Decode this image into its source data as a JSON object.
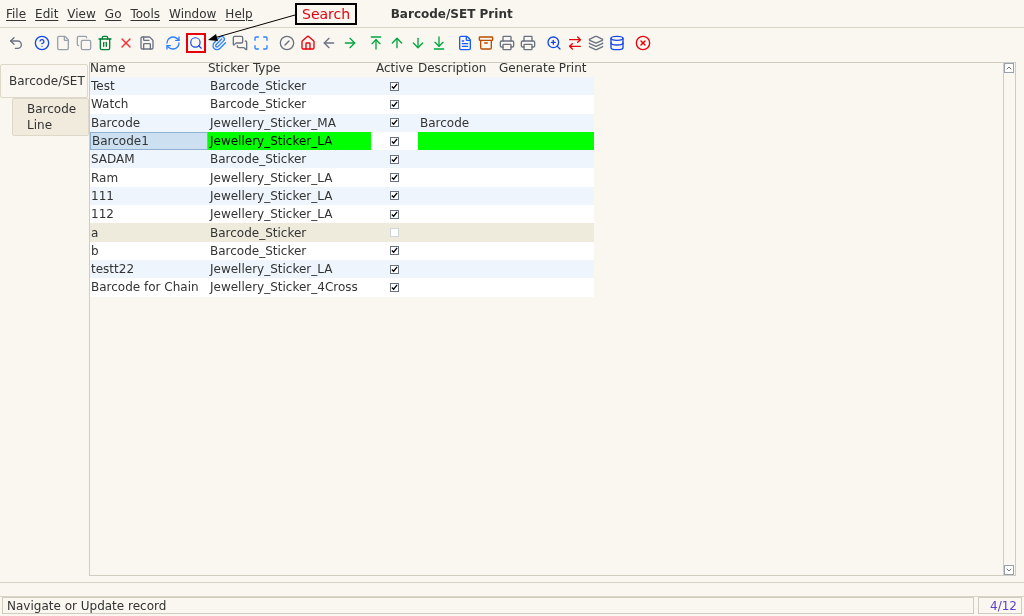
{
  "menu": [
    "File",
    "Edit",
    "View",
    "Go",
    "Tools",
    "Window",
    "Help"
  ],
  "window": {
    "title": "Barcode/SET Print"
  },
  "callout": {
    "label": "Search"
  },
  "tabs": [
    {
      "label": "Barcode/SET",
      "selected": true
    },
    {
      "label": "Barcode Line",
      "selected": false
    }
  ],
  "table": {
    "columns": [
      "Name",
      "Sticker Type",
      "Active",
      "Description",
      "Generate Print"
    ],
    "rows": [
      {
        "name": "Test",
        "sticker_type": "Barcode_Sticker",
        "active": true,
        "selected": false
      },
      {
        "name": "Watch",
        "sticker_type": "Barcode_Sticker",
        "active": true,
        "selected": false
      },
      {
        "name": "Barcode",
        "sticker_type": "Jewellery_Sticker_MA",
        "active": true,
        "description": "Barcode",
        "selected": false
      },
      {
        "name": "Barcode1",
        "sticker_type": "Jewellery_Sticker_LA",
        "active": true,
        "selected": true
      },
      {
        "name": "SADAM",
        "sticker_type": "Barcode_Sticker",
        "active": true,
        "selected": false
      },
      {
        "name": "Ram",
        "sticker_type": "Jewellery_Sticker_LA",
        "active": true,
        "selected": false
      },
      {
        "name": "111",
        "sticker_type": "Jewellery_Sticker_LA",
        "active": true,
        "selected": false
      },
      {
        "name": "112",
        "sticker_type": "Jewellery_Sticker_LA",
        "active": true,
        "selected": false
      },
      {
        "name": "a",
        "sticker_type": "Barcode_Sticker",
        "active": false,
        "selected": false
      },
      {
        "name": "b",
        "sticker_type": "Barcode_Sticker",
        "active": true,
        "selected": false
      },
      {
        "name": "testt22",
        "sticker_type": "Jewellery_Sticker_LA",
        "active": true,
        "selected": false
      },
      {
        "name": "Barcode for Chain",
        "sticker_type": "Jewellery_Sticker_4Cross",
        "active": true,
        "selected": false
      }
    ]
  },
  "status_bar": {
    "message": "Navigate or Update record",
    "record": "4/12"
  }
}
